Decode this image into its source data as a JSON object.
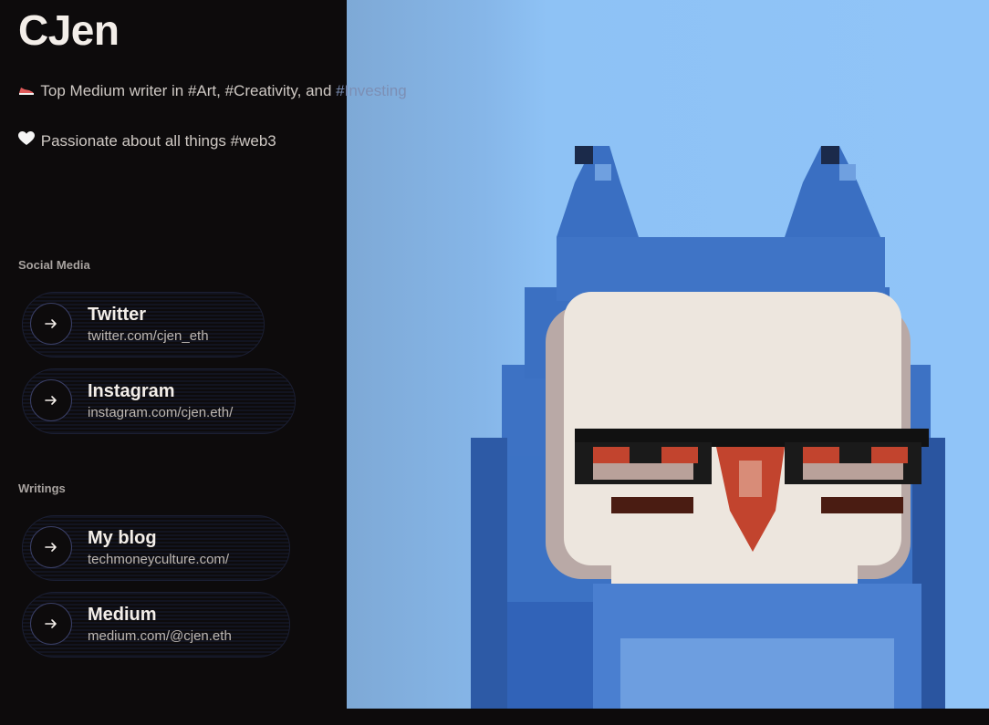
{
  "profile": {
    "name": "CJen",
    "bio_line1_prefix": "Top Medium writer in #Art, #Creativity, and ",
    "bio_line1_suffix": "#Investing",
    "bio_line2": "Passionate about all things #web3"
  },
  "sections": {
    "social_title": "Social Media",
    "writings_title": "Writings"
  },
  "links": {
    "twitter": {
      "title": "Twitter",
      "url": "twitter.com/cjen_eth"
    },
    "instagram": {
      "title": "Instagram",
      "url": "instagram.com/cjen.eth/"
    },
    "blog": {
      "title": "My blog",
      "url": "techmoneyculture.com/"
    },
    "medium": {
      "title": "Medium",
      "url": "medium.com/@cjen.eth"
    }
  },
  "icons": {
    "bio1": "shoe-icon",
    "bio2": "white-heart-icon",
    "link": "arrow-right-icon",
    "image": "pixel-owl-avatar"
  },
  "colors": {
    "background": "#0d0b0c",
    "sky": "#90c4f8",
    "owl_blue": "#3d72c4",
    "owl_face": "#ede6de",
    "beak": "#c2442e"
  }
}
